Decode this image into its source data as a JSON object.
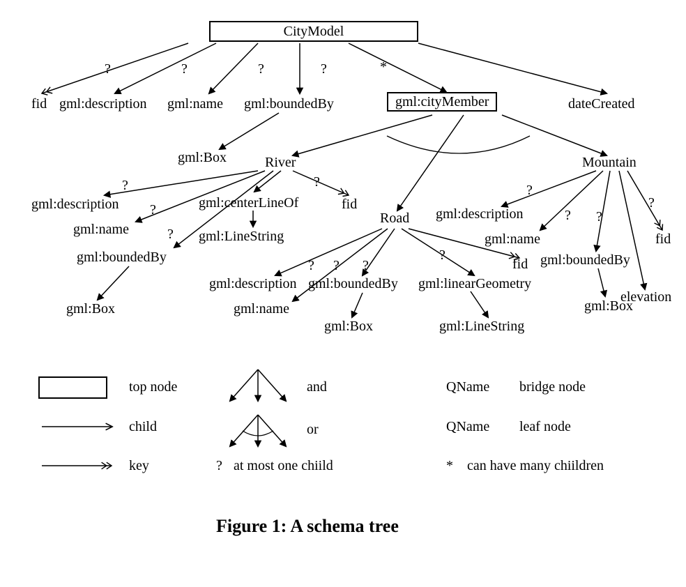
{
  "caption": "Figure 1: A schema tree",
  "nodes": {
    "root": "CityModel",
    "fid": "fid",
    "gml_description": "gml:description",
    "gml_name": "gml:name",
    "gml_boundedBy": "gml:boundedBy",
    "gml_cityMember": "gml:cityMember",
    "dateCreated": "dateCreated",
    "gml_Box": "gml:Box",
    "River": "River",
    "Mountain": "Mountain",
    "gml_centerLineOf": "gml:centerLineOf",
    "gml_LineString": "gml:LineString",
    "Road": "Road",
    "gml_linearGeometry": "gml:linearGeometry",
    "elevation": "elevation"
  },
  "annot": {
    "q": "?",
    "star": "*"
  },
  "legend": {
    "top_node": "top node",
    "child": "child",
    "key": "key",
    "and": "and",
    "or": "or",
    "at_most_one": "at most one chiild",
    "bridge_node": "bridge node",
    "leaf_node": "leaf node",
    "many_children": "can have many chiildren",
    "qname": "QName",
    "q": "?",
    "star": "*"
  }
}
